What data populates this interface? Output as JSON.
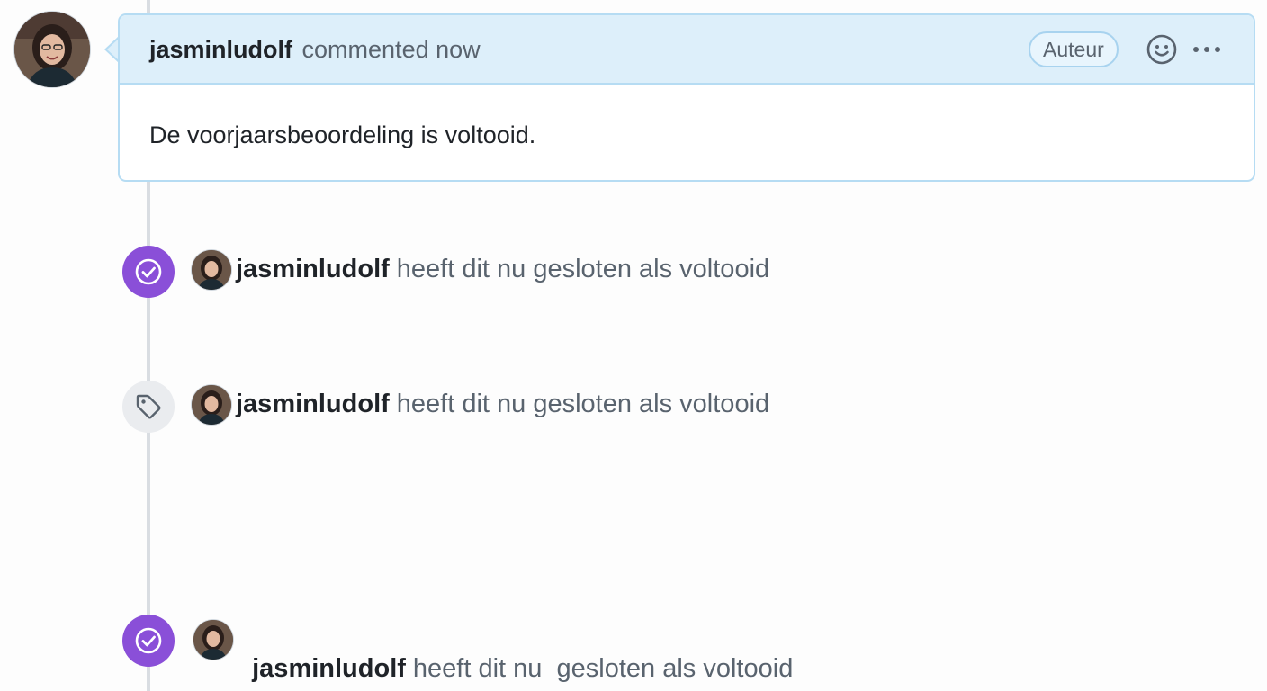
{
  "comment": {
    "author": "jasminludolf",
    "meta": "commented now",
    "role_badge": "Auteur",
    "body": "De voorjaarsbeoordeling is voltooid.",
    "reaction_icon": "smiley-icon",
    "menu_icon": "kebab-horizontal-icon"
  },
  "events": [
    {
      "actor": "jasminludolf",
      "action": "heeft dit nu gesloten als voltooid",
      "icon": "check-circle-icon",
      "badge_color": "#8a4fd8"
    },
    {
      "actor": "jasminludolf",
      "action": "heeft dit nu gesloten als voltooid",
      "icon": "tag-icon",
      "badge_color": "#eaecef"
    },
    {
      "actor": "jasminludolf",
      "action": "heeft dit nu  gesloten als voltooid",
      "icon": "check-circle-icon",
      "badge_color": "#8a4fd8"
    }
  ]
}
